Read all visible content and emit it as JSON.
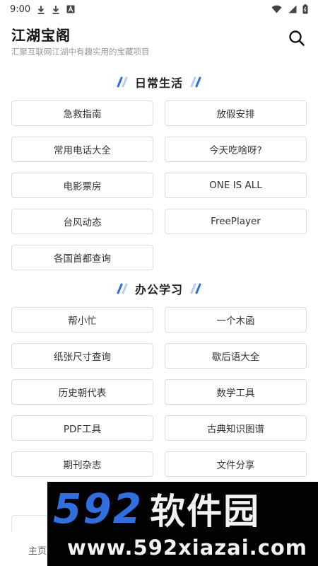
{
  "status_bar": {
    "time": "9:00",
    "icons": [
      "download-icon",
      "download-icon",
      "notification-a-icon",
      "wifi-icon",
      "signal-icon",
      "battery-icon"
    ]
  },
  "header": {
    "title": "江湖宝阁",
    "subtitle": "汇聚互联网江湖中有趣实用的宝藏项目",
    "search_icon": "search-icon"
  },
  "sections": [
    {
      "title": "日常生活",
      "items": [
        "急救指南",
        "放假安排",
        "常用电话大全",
        "今天吃啥呀?",
        "电影票房",
        "ONE  IS ALL",
        "台风动态",
        "FreePlayer",
        "各国首都查询"
      ]
    },
    {
      "title": "办公学习",
      "items": [
        "帮小忙",
        "一个木函",
        "纸张尺寸查询",
        "歇后语大全",
        "历史朝代表",
        "数学工具",
        "PDF工具",
        "古典知识图谱",
        "期刊杂志",
        "文件分享"
      ]
    }
  ],
  "bottom_nav": {
    "home_label": "主页"
  },
  "watermark": {
    "digits": "592",
    "text": "软件园",
    "url": "www.592xiazai.com"
  },
  "colors": {
    "accent_blue": "#2f6fe0",
    "slash_light": "#b9cdf3",
    "tile_border": "#dcdcdc",
    "subtitle_gray": "#999999"
  }
}
